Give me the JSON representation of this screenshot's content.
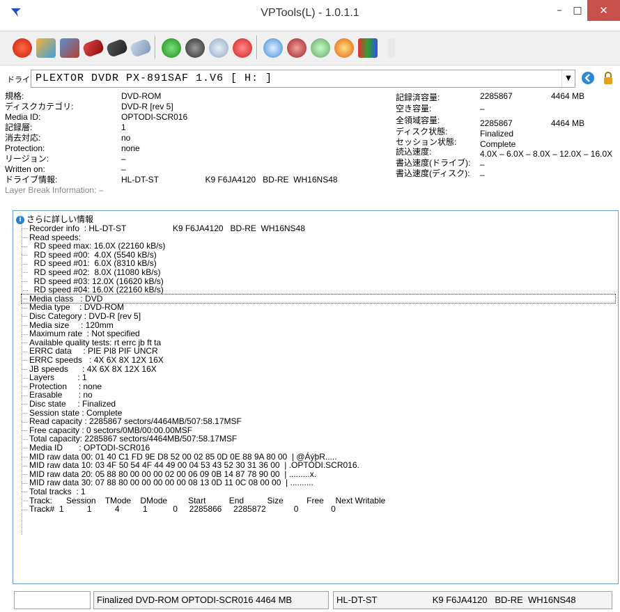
{
  "window": {
    "title": "VPTools(L) - 1.0.1.1",
    "minimize": "–",
    "maximize": "□",
    "close": "✕"
  },
  "drive": {
    "label": "ドライブ:",
    "value": "PLEXTOR  DVDR   PX-891SAF 1.V6  [ H: ]"
  },
  "info_left": [
    {
      "label": "規格:",
      "value": "DVD-ROM"
    },
    {
      "label": "ディスクカテゴリ:",
      "value": "DVD-R [rev 5]"
    },
    {
      "label": "Media ID:",
      "value": "OPTODI-SCR016"
    },
    {
      "label": "記録層:",
      "value": "1"
    },
    {
      "label": "消去対応:",
      "value": "no"
    },
    {
      "label": "Protection:",
      "value": "none"
    },
    {
      "label": "リージョン:",
      "value": "–"
    },
    {
      "label": "Written on:",
      "value": "–"
    },
    {
      "label": "ドライブ情報:",
      "value": "HL-DT-ST                    K9 F6JA4120   BD-RE  WH16NS48"
    }
  ],
  "layer_break": "Layer Break Information: –",
  "info_right": [
    {
      "label": "記録済容量:",
      "value": "2285867",
      "extra": "4464 MB"
    },
    {
      "label": "空き容量:",
      "value": "–",
      "extra": ""
    },
    {
      "label": "全領域容量:",
      "value": "2285867",
      "extra": "4464 MB"
    },
    {
      "label": "ディスク状態:",
      "value": "Finalized",
      "extra": ""
    },
    {
      "label": "セッション状態:",
      "value": "Complete",
      "extra": ""
    },
    {
      "label": "読込速度:",
      "value": "4.0X – 6.0X – 8.0X – 12.0X – 16.0X",
      "extra": ""
    },
    {
      "label": "書込速度(ドライブ):",
      "value": "–",
      "extra": ""
    },
    {
      "label": "書込速度(ディスク):",
      "value": "–",
      "extra": ""
    }
  ],
  "details": {
    "root": "さらに詳しい情報",
    "lines": [
      "Recorder info  : HL-DT-ST                    K9 F6JA4120   BD-RE  WH16NS48",
      "Read speeds:",
      "  RD speed max: 16.0X (22160 kB/s)",
      "  RD speed #00:  4.0X (5540 kB/s)",
      "  RD speed #01:  6.0X (8310 kB/s)",
      "  RD speed #02:  8.0X (11080 kB/s)",
      "  RD speed #03: 12.0X (16620 kB/s)",
      "  RD speed #04: 16.0X (22160 kB/s)",
      "Media class   : DVD",
      "Media type    : DVD-ROM",
      "Disc Category : DVD-R [rev 5]",
      "Media size     : 120mm",
      "Maximum rate  : Not specified",
      "Available quality tests: rt errc jb ft ta",
      "ERRC data     : PIE PI8 PIF UNCR",
      "ERRC speeds   : 4X 6X 8X 12X 16X",
      "JB speeds      : 4X 6X 8X 12X 16X",
      "Layers          : 1",
      "Protection     : none",
      "Erasable       : no",
      "Disc state     : Finalized",
      "Session state : Complete",
      "Read capacity : 2285867 sectors/4464MB/507:58.17MSF",
      "Free capacity : 0 sectors/0MB/00:00.00MSF",
      "Total capacity: 2285867 sectors/4464MB/507:58.17MSF",
      "Media ID       : OPTODI-SCR016",
      "MID raw data 00: 01 40 C1 FD 9E D8 52 00 02 85 0D 0E 88 9A 80 00  | @ÁýþR.....",
      "MID raw data 10: 03 4F 50 54 4F 44 49 00 04 53 43 52 30 31 36 00  | .OPTODI.SCR016.",
      "MID raw data 20: 05 88 80 00 00 00 02 00 06 09 0B 14 87 78 90 00  | .........x.",
      "MID raw data 30: 07 88 80 00 00 00 00 00 08 13 0D 11 0C 08 00 00  | ..........",
      "Total tracks  : 1",
      "Track:      Session    TMode    DMode         Start          End          Size          Free     Next Writable",
      "Track#  1          1          4          1           0     2285866     2285872            0              0"
    ],
    "selected_index": 8
  },
  "status": {
    "cell1": "",
    "cell2": "Finalized  DVD-ROM  OPTODI-SCR016  4464 MB",
    "cell3": "HL-DT-ST                      K9 F6JA4120   BD-RE  WH16NS48"
  },
  "toolbar_icons": [
    "power-icon",
    "wrench-icon",
    "write-image-icon",
    "red-disc-icon",
    "black-disc-icon",
    "disc-copy-icon",
    "refresh-icon",
    "burn-icon",
    "disc-info-icon",
    "stop-icon",
    "optical-icon",
    "disc-stack-icon",
    "disc-gear-icon",
    "fire-icon",
    "chart-icon",
    "pin-icon"
  ]
}
